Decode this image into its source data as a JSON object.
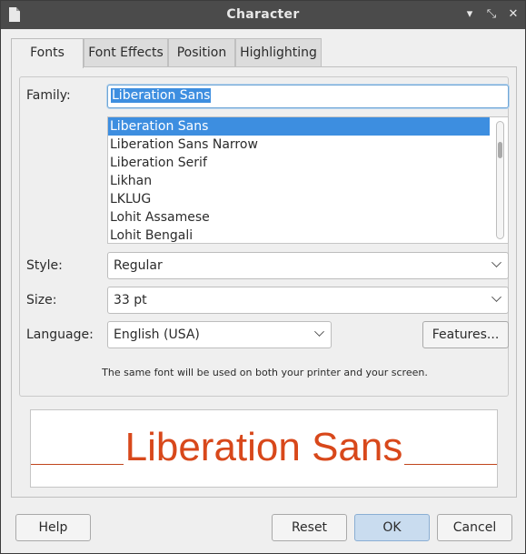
{
  "window": {
    "title": "Character",
    "icon": "document-icon",
    "controls": [
      "minimize",
      "maximize",
      "close"
    ]
  },
  "tabs": [
    {
      "label": "Fonts",
      "active": true
    },
    {
      "label": "Font Effects",
      "active": false
    },
    {
      "label": "Position",
      "active": false
    },
    {
      "label": "Highlighting",
      "active": false
    }
  ],
  "fonts": {
    "family_label": "Family:",
    "family_value": "Liberation Sans",
    "font_list": [
      "Liberation Sans",
      "Liberation Sans Narrow",
      "Liberation Serif",
      "Likhan",
      "LKLUG",
      "Lohit Assamese",
      "Lohit Bengali"
    ],
    "selected_font": "Liberation Sans",
    "style_label": "Style:",
    "style_value": "Regular",
    "size_label": "Size:",
    "size_value": "33 pt",
    "language_label": "Language:",
    "language_value": "English (USA)",
    "features_button": "Features...",
    "note": "The same font will be used on both your printer and your screen."
  },
  "preview": {
    "text": "Liberation Sans",
    "color": "#d8481b"
  },
  "buttons": {
    "help": "Help",
    "reset": "Reset",
    "ok": "OK",
    "cancel": "Cancel"
  },
  "colors": {
    "titlebar": "#4b4b4b",
    "selection": "#3d8ee0",
    "primary_button": "#c9dcef"
  }
}
